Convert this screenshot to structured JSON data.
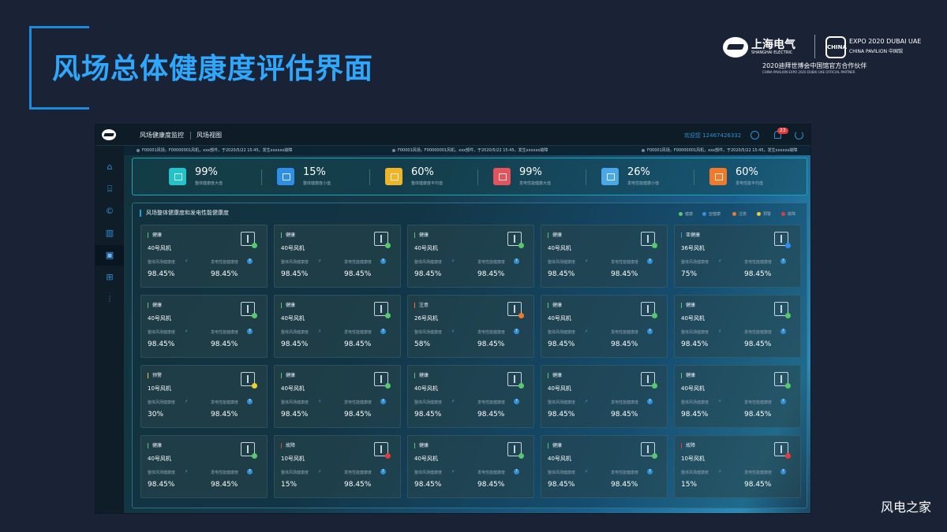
{
  "slide": {
    "title": "风场总体健康度评估界面",
    "brand": {
      "shanghai_electric_cn": "上海电气",
      "shanghai_electric_en": "SHANGHAI ELECTRIC",
      "expo_logo_text": "CHINA",
      "expo_line1": "EXPO 2020 DUBAI UAE",
      "expo_line2": "CHINA PAVILION 中国馆",
      "partner_cn": "2020迪拜世博会中国馆官方合作伙伴",
      "partner_en": "CHINA PAVILION EXPO 2020 DUBAI UAE OFFICIAL PARTNER"
    },
    "footer": "风电之家"
  },
  "app": {
    "nav": [
      "风场健康度监控",
      "风场视图"
    ],
    "user": "欢迎您 12467426332",
    "notification_count": "23",
    "sidebar_icons": [
      "home-icon",
      "bank-icon",
      "copyright-icon",
      "bar-chart-icon",
      "monitor-icon",
      "cart-icon",
      "sliders-icon"
    ],
    "ticker": [
      "F00001风场，F00000001风机，xxx部件，于2020/5/22 15:45，发生xxxxxx故障",
      "F00001风场，F00000001风机，xxx部件，于2020/5/22 15:45，发生xxxxxx故障",
      "F00001风场，F00000001风机，xxx部件，于2020/5/22 15:45，发生xxxxxx故障"
    ],
    "kpis": [
      {
        "value": "99%",
        "label": "整体健康度大值",
        "color": "#22c3c9"
      },
      {
        "value": "15%",
        "label": "整体健康度小值",
        "color": "#2f8fe8"
      },
      {
        "value": "60%",
        "label": "整体健康度平均值",
        "color": "#f0b429"
      },
      {
        "value": "99%",
        "label": "发电性能健康大值",
        "color": "#e5545c"
      },
      {
        "value": "26%",
        "label": "发电性能健康小值",
        "color": "#4aa8e8"
      },
      {
        "value": "60%",
        "label": "发电性能平均值",
        "color": "#f07a2a"
      }
    ],
    "panel_title": "风场整体健康度和发电性能健康度",
    "legend": [
      {
        "label": "健康",
        "color": "#56c96a"
      },
      {
        "label": "亚健康",
        "color": "#2f8fe8"
      },
      {
        "label": "注意",
        "color": "#f07a2a"
      },
      {
        "label": "预警",
        "color": "#f0d02a"
      },
      {
        "label": "故障",
        "color": "#e53b3b"
      }
    ],
    "metric_labels": {
      "overall": "整体风场健康度",
      "power": "发电性能健康度"
    },
    "cards": [
      {
        "status": "健康",
        "name": "40号风机",
        "overall": "98.45%",
        "power": "98.45%",
        "color": "#56c96a"
      },
      {
        "status": "健康",
        "name": "40号风机",
        "overall": "98.45%",
        "power": "98.45%",
        "color": "#56c96a"
      },
      {
        "status": "健康",
        "name": "40号风机",
        "overall": "98.45%",
        "power": "98.45%",
        "color": "#56c96a"
      },
      {
        "status": "健康",
        "name": "40号风机",
        "overall": "98.45%",
        "power": "98.45%",
        "color": "#56c96a"
      },
      {
        "status": "亚健康",
        "name": "36号风机",
        "overall": "75%",
        "power": "98.45%",
        "color": "#2f8fe8"
      },
      {
        "status": "健康",
        "name": "40号风机",
        "overall": "98.45%",
        "power": "98.45%",
        "color": "#56c96a"
      },
      {
        "status": "健康",
        "name": "40号风机",
        "overall": "98.45%",
        "power": "98.45%",
        "color": "#56c96a"
      },
      {
        "status": "注意",
        "name": "26号风机",
        "overall": "58%",
        "power": "98.45%",
        "color": "#f07a2a"
      },
      {
        "status": "健康",
        "name": "40号风机",
        "overall": "98.45%",
        "power": "98.45%",
        "color": "#56c96a"
      },
      {
        "status": "健康",
        "name": "40号风机",
        "overall": "98.45%",
        "power": "98.45%",
        "color": "#56c96a"
      },
      {
        "status": "预警",
        "name": "10号风机",
        "overall": "30%",
        "power": "98.45%",
        "color": "#f0d02a"
      },
      {
        "status": "健康",
        "name": "40号风机",
        "overall": "98.45%",
        "power": "98.45%",
        "color": "#56c96a"
      },
      {
        "status": "健康",
        "name": "40号风机",
        "overall": "98.45%",
        "power": "98.45%",
        "color": "#56c96a"
      },
      {
        "status": "健康",
        "name": "40号风机",
        "overall": "98.45%",
        "power": "98.45%",
        "color": "#56c96a"
      },
      {
        "status": "健康",
        "name": "40号风机",
        "overall": "98.45%",
        "power": "98.45%",
        "color": "#56c96a"
      },
      {
        "status": "健康",
        "name": "40号风机",
        "overall": "98.45%",
        "power": "98.45%",
        "color": "#56c96a"
      },
      {
        "status": "故障",
        "name": "10号风机",
        "overall": "15%",
        "power": "98.45%",
        "color": "#e53b3b"
      },
      {
        "status": "健康",
        "name": "40号风机",
        "overall": "98.45%",
        "power": "98.45%",
        "color": "#56c96a"
      },
      {
        "status": "健康",
        "name": "40号风机",
        "overall": "98.45%",
        "power": "98.45%",
        "color": "#56c96a"
      },
      {
        "status": "故障",
        "name": "10号风机",
        "overall": "15%",
        "power": "98.45%",
        "color": "#e53b3b"
      }
    ]
  }
}
